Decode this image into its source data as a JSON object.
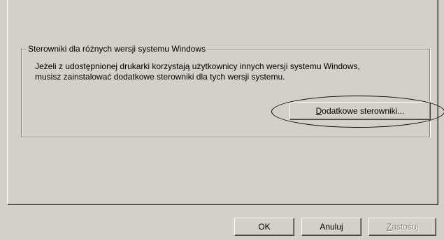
{
  "groupbox": {
    "title": "Sterowniki dla różnych wersji systemu Windows",
    "description_line1": "Jeżeli z udostępnionej drukarki korzystają użytkownicy innych wersji systemu Windows,",
    "description_line2": "musisz zainstalować dodatkowe sterowniki dla tych wersji systemu.",
    "additional_drivers_button": {
      "mnemonic": "D",
      "label_rest": "odatkowe sterowniki..."
    }
  },
  "dialog_buttons": {
    "ok": "OK",
    "cancel": "Anuluj",
    "apply_mnemonic": "Z",
    "apply_rest": "astosuj"
  }
}
